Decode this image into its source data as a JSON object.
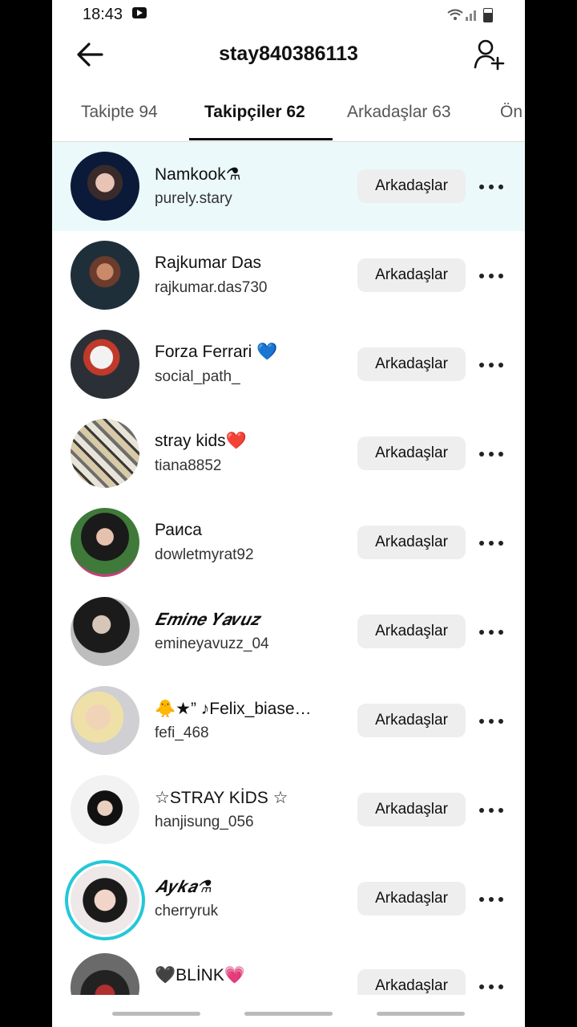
{
  "status": {
    "time": "18:43"
  },
  "header": {
    "title": "stay840386113"
  },
  "tabs": [
    {
      "label": "Takipte 94"
    },
    {
      "label": "Takipçiler 62"
    },
    {
      "label": "Arkadaşlar 63"
    },
    {
      "label": "Ön"
    }
  ],
  "users": [
    {
      "name": "Namkook⚗",
      "handle": "purely.stary",
      "button": "Arkadaşlar"
    },
    {
      "name": "Rajkumar Das",
      "handle": "rajkumar.das730",
      "button": "Arkadaşlar"
    },
    {
      "name": "Forza Ferrari 💙",
      "handle": "social_path_",
      "button": "Arkadaşlar"
    },
    {
      "name": "stray kids❤️",
      "handle": "tiana8852",
      "button": "Arkadaşlar"
    },
    {
      "name": "Раиса",
      "handle": "dowletmyrat92",
      "button": "Arkadaşlar"
    },
    {
      "name": "𝑬𝒎𝒊𝒏𝒆 𝒀𝒂𝒗𝒖𝒛",
      "handle": "emineyavuzz_04",
      "button": "Arkadaşlar"
    },
    {
      "name": "🐥★” ♪Felix_biase…",
      "handle": "fefi_468",
      "button": "Arkadaşlar"
    },
    {
      "name": "☆STRAY KİDS ☆",
      "handle": "hanjisung_056",
      "button": "Arkadaşlar"
    },
    {
      "name": "𝑨𝒚𝒌𝒂⚗",
      "handle": "cherryruk",
      "button": "Arkadaşlar"
    },
    {
      "name": "🖤BLİNK💗",
      "handle": "",
      "button": "Arkadaşlar"
    }
  ],
  "colors": {
    "highlight": "#ebf9fb",
    "story_ring": "#23c8d8"
  }
}
